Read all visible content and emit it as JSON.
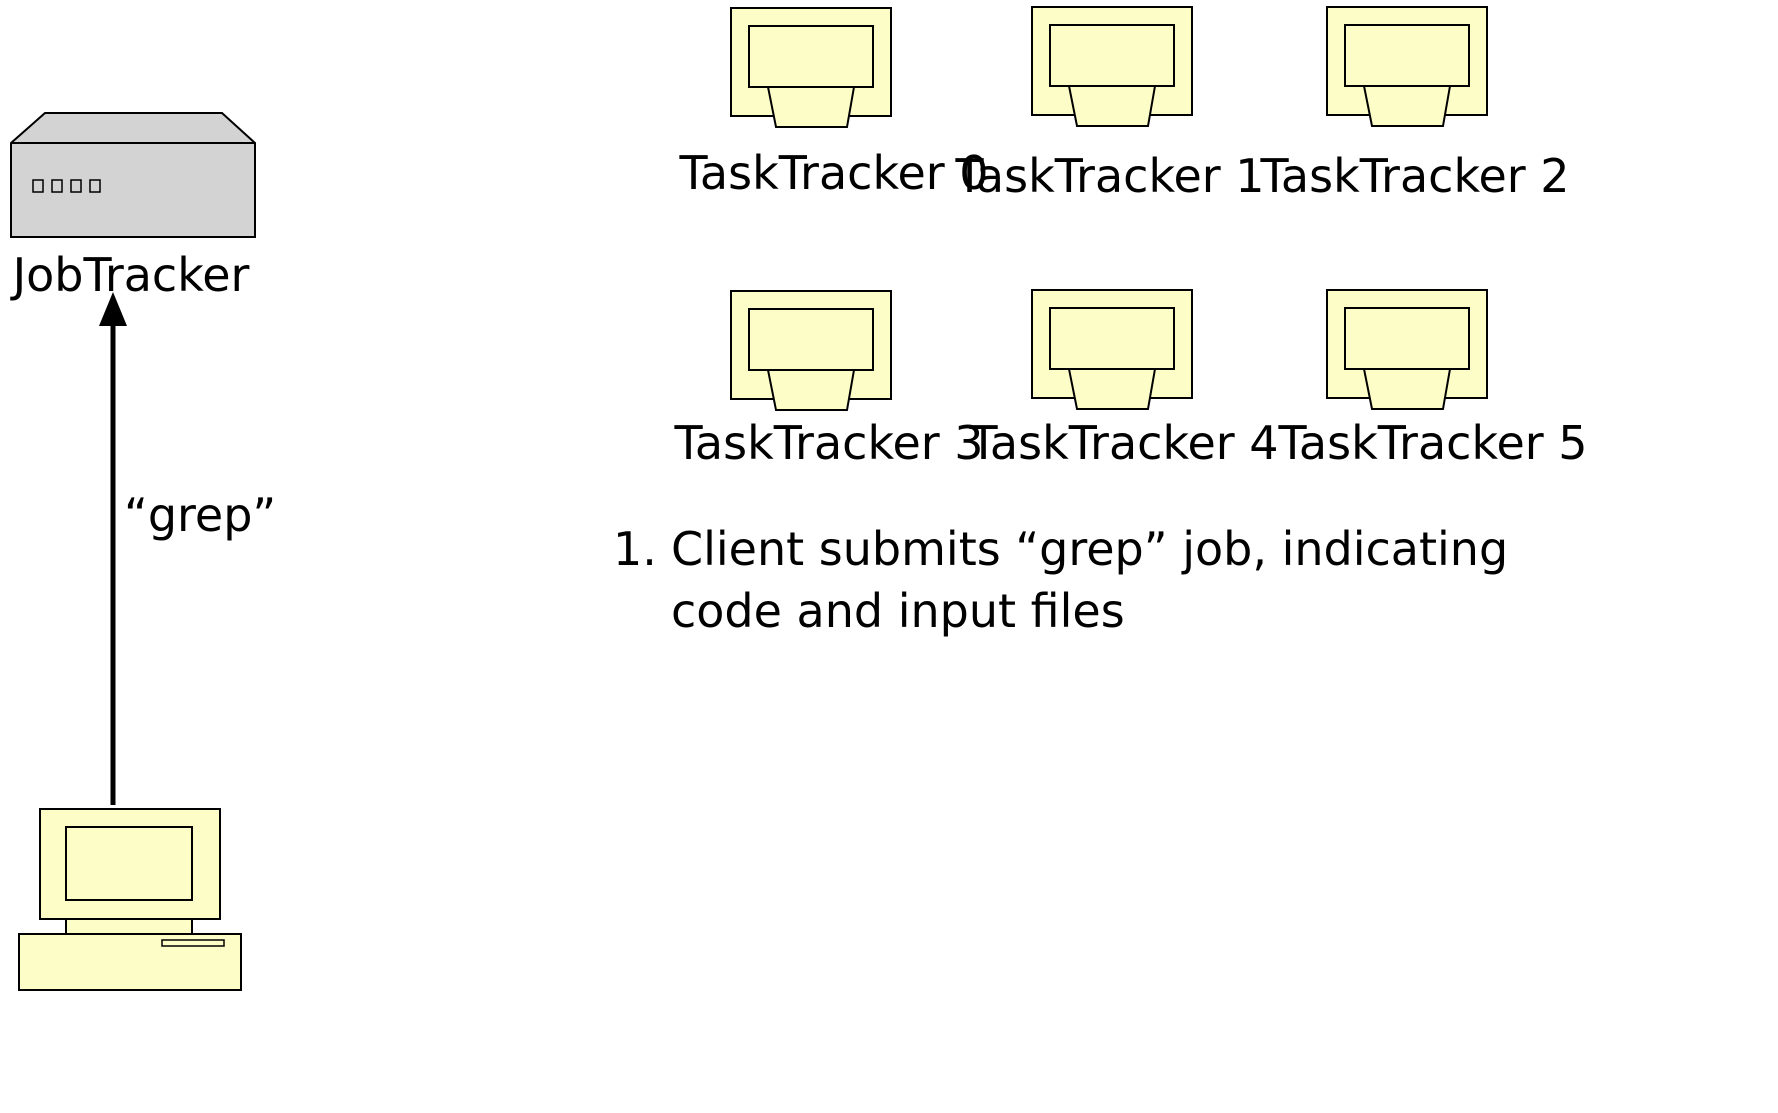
{
  "colors": {
    "node_fill": "#fdfdc8",
    "server_fill": "#d3d3d3",
    "stroke": "#000000"
  },
  "job_tracker": {
    "label": "JobTracker",
    "icon": "server-icon"
  },
  "request": {
    "label": "“grep”",
    "arrow": "arrow-up-icon"
  },
  "client": {
    "icon": "desktop-computer-icon"
  },
  "task_trackers": [
    {
      "label": "TaskTracker 0",
      "icon": "monitor-icon"
    },
    {
      "label": "TaskTracker 1",
      "icon": "monitor-icon"
    },
    {
      "label": "TaskTracker 2",
      "icon": "monitor-icon"
    },
    {
      "label": "TaskTracker 3",
      "icon": "monitor-icon"
    },
    {
      "label": "TaskTracker 4",
      "icon": "monitor-icon"
    },
    {
      "label": "TaskTracker 5",
      "icon": "monitor-icon"
    }
  ],
  "steps": [
    {
      "number": "1.",
      "text": "Client submits “grep” job, indicating code and input files"
    }
  ]
}
